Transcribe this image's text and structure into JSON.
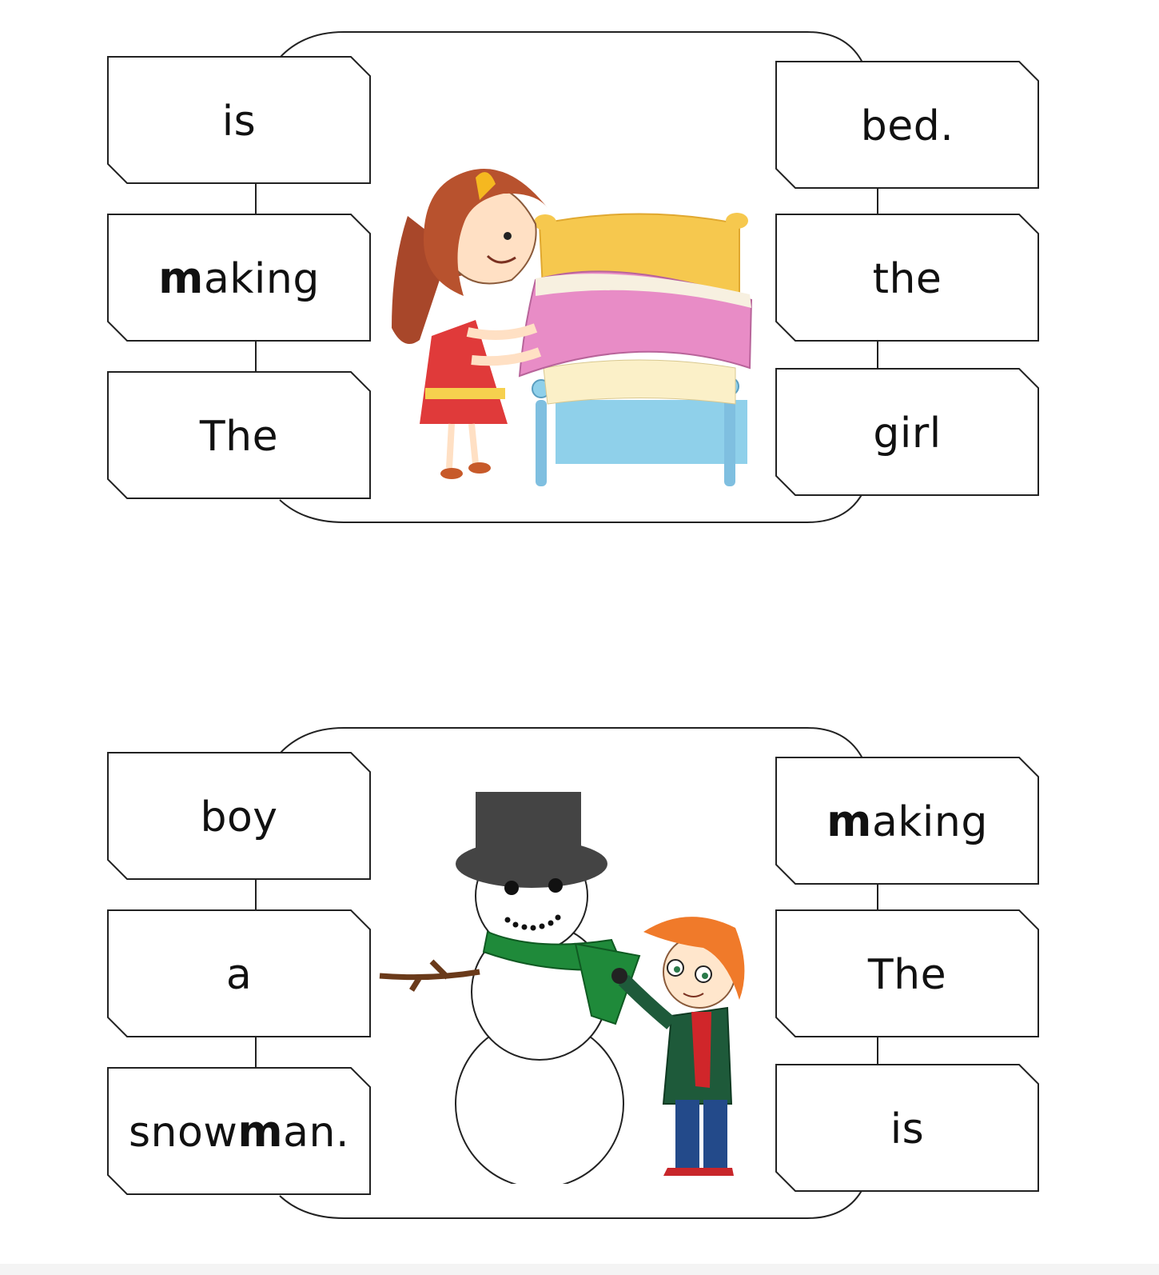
{
  "panels": [
    {
      "illustration": "girl-making-bed",
      "cards_left": [
        {
          "pre": "",
          "bold": "",
          "post": "is"
        },
        {
          "pre": "",
          "bold": "m",
          "post": "aking"
        },
        {
          "pre": "",
          "bold": "",
          "post": "The"
        }
      ],
      "cards_right": [
        {
          "pre": "",
          "bold": "",
          "post": "bed."
        },
        {
          "pre": "",
          "bold": "",
          "post": "the"
        },
        {
          "pre": "",
          "bold": "",
          "post": "girl"
        }
      ]
    },
    {
      "illustration": "boy-building-snowman",
      "cards_left": [
        {
          "pre": "",
          "bold": "",
          "post": "boy"
        },
        {
          "pre": "",
          "bold": "",
          "post": "a"
        },
        {
          "pre": "snow",
          "bold": "m",
          "post": "an."
        }
      ],
      "cards_right": [
        {
          "pre": "",
          "bold": "m",
          "post": "aking"
        },
        {
          "pre": "",
          "bold": "",
          "post": "The"
        },
        {
          "pre": "",
          "bold": "",
          "post": "is"
        }
      ]
    }
  ]
}
